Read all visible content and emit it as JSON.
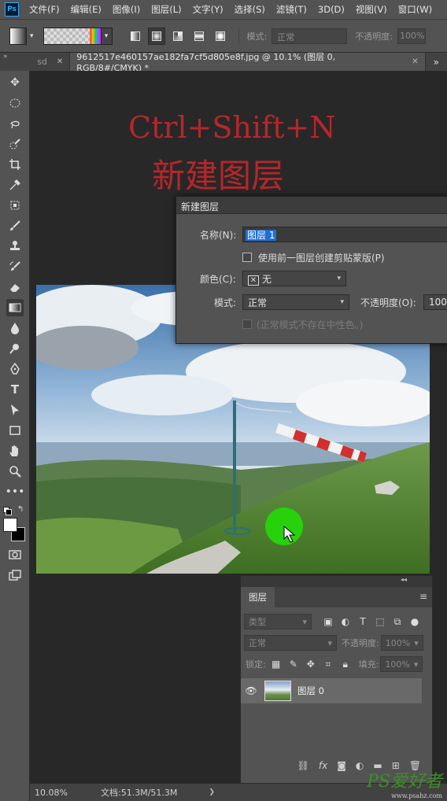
{
  "app": {
    "logo": "Ps"
  },
  "menu": [
    "文件(F)",
    "编辑(E)",
    "图像(I)",
    "图层(L)",
    "文字(Y)",
    "选择(S)",
    "滤镜(T)",
    "3D(D)",
    "视图(V)",
    "窗口(W)"
  ],
  "options": {
    "mode_label": "模式:",
    "mode_value": "正常",
    "opacity_label": "不透明度:",
    "opacity_value": "100%"
  },
  "tabs": {
    "prev_tab": "sd",
    "active_tab": "9612517e460157ae182fa7cf5d805e8f.jpg @ 10.1% (图层 0, RGB/8#/CMYK) *",
    "more": "»"
  },
  "overlay": {
    "shortcut": "Ctrl+Shift+N",
    "title": "新建图层"
  },
  "dialog": {
    "title": "新建图层",
    "name_label": "名称(N):",
    "name_value": "图层 1",
    "clip_label": "使用前一图层创建剪贴蒙版(P)",
    "color_label": "颜色(C):",
    "color_value": "无",
    "mode_label": "模式:",
    "mode_value": "正常",
    "opacity_label": "不透明度(O):",
    "opacity_value": "100",
    "neutral_label": "(正常模式不存在中性色。)"
  },
  "layers_panel": {
    "tab": "图层",
    "filter_value": "类型",
    "blend_value": "正常",
    "opacity_label": "不透明度:",
    "opacity_value": "100%",
    "lock_label": "锁定:",
    "fill_label": "填充:",
    "fill_value": "100%",
    "layer_name": "图层 0"
  },
  "status": {
    "zoom": "10.08%",
    "doc": "文档:51.3M/51.3M"
  },
  "watermark": {
    "brand": "PS爱好者",
    "url": "www.psahz.com"
  },
  "colors": {
    "accent": "#31a8ff",
    "overlay_red": "#b7262c",
    "ui_bg": "#535353",
    "canvas_bg": "#282828"
  }
}
